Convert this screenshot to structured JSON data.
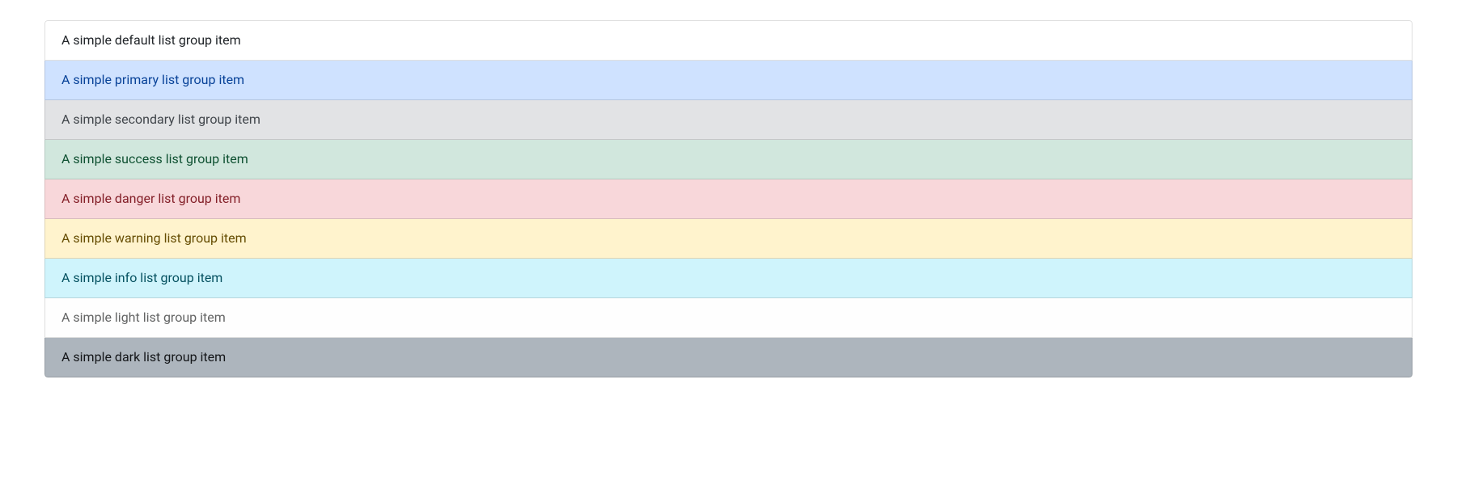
{
  "list_group": {
    "items": [
      {
        "variant": "default",
        "label": "A simple default list group item"
      },
      {
        "variant": "primary",
        "label": "A simple primary list group item"
      },
      {
        "variant": "secondary",
        "label": "A simple secondary list group item"
      },
      {
        "variant": "success",
        "label": "A simple success list group item"
      },
      {
        "variant": "danger",
        "label": "A simple danger list group item"
      },
      {
        "variant": "warning",
        "label": "A simple warning list group item"
      },
      {
        "variant": "info",
        "label": "A simple info list group item"
      },
      {
        "variant": "light",
        "label": "A simple light list group item"
      },
      {
        "variant": "dark",
        "label": "A simple dark list group item"
      }
    ]
  }
}
